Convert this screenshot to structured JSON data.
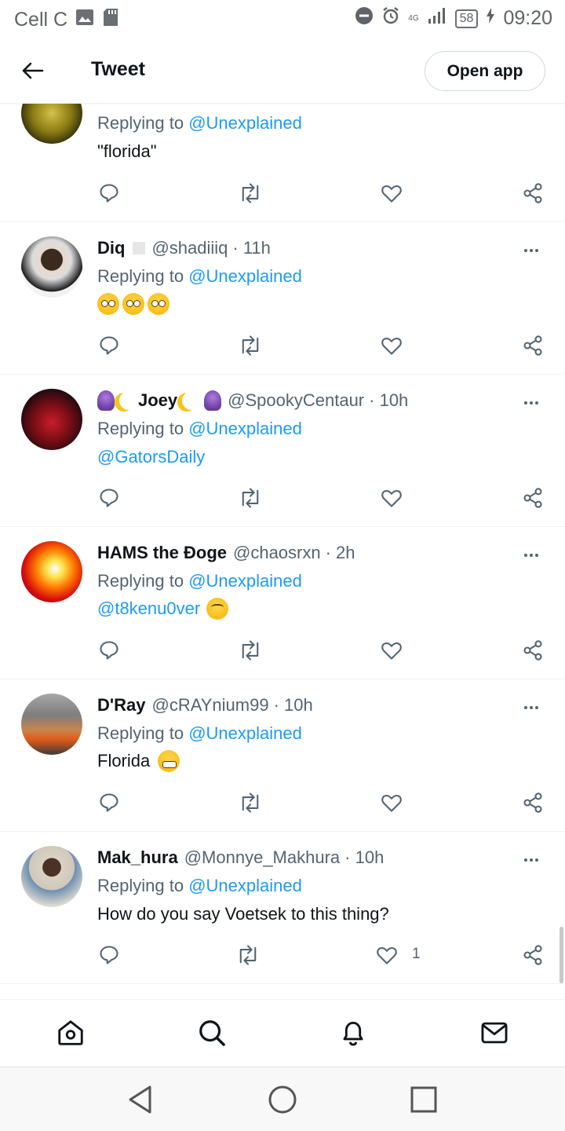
{
  "status_bar": {
    "carrier": "Cell C",
    "network": "4G",
    "battery": "58",
    "time": "09:20"
  },
  "header": {
    "title": "Tweet",
    "open_app": "Open app"
  },
  "tweets": [
    {
      "name": "",
      "handle": "",
      "time": "",
      "replying_prefix": "Replying to",
      "replying_to": "@Unexplained",
      "text": "\"florida\"",
      "likes": ""
    },
    {
      "name": "Diq",
      "handle": "@shadiiiq",
      "time": "· 11h",
      "replying_prefix": "Replying to",
      "replying_to": "@Unexplained",
      "text": "",
      "likes": ""
    },
    {
      "name": "Joey",
      "handle": "@SpookyCentaur",
      "time": "· 10h",
      "replying_prefix": "Replying to",
      "replying_to": "@Unexplained",
      "text_link": "@GatorsDaily",
      "likes": ""
    },
    {
      "name": "HAMS the Đoge",
      "handle": "@chaosrxn",
      "time": "· 2h",
      "replying_prefix": "Replying to",
      "replying_to": "@Unexplained",
      "text_link": "@t8kenu0ver",
      "likes": ""
    },
    {
      "name": "D'Ray",
      "handle": "@cRAYnium99",
      "time": "· 10h",
      "replying_prefix": "Replying to",
      "replying_to": "@Unexplained",
      "text": "Florida",
      "likes": ""
    },
    {
      "name": "Mak_hura",
      "handle": "@Monnye_Makhura",
      "time": "· 10h",
      "replying_prefix": "Replying to",
      "replying_to": "@Unexplained",
      "text": "How do you say Voetsek to this thing?",
      "likes": "1"
    }
  ],
  "colors": {
    "link": "#1d9bf0",
    "text": "#0f1419",
    "muted": "#536471"
  },
  "icons": {
    "back": "arrow-left-icon",
    "reply": "reply-icon",
    "retweet": "retweet-icon",
    "like": "heart-icon",
    "share": "share-icon",
    "home": "home-icon",
    "search": "search-icon",
    "notifications": "bell-icon",
    "messages": "mail-icon"
  }
}
